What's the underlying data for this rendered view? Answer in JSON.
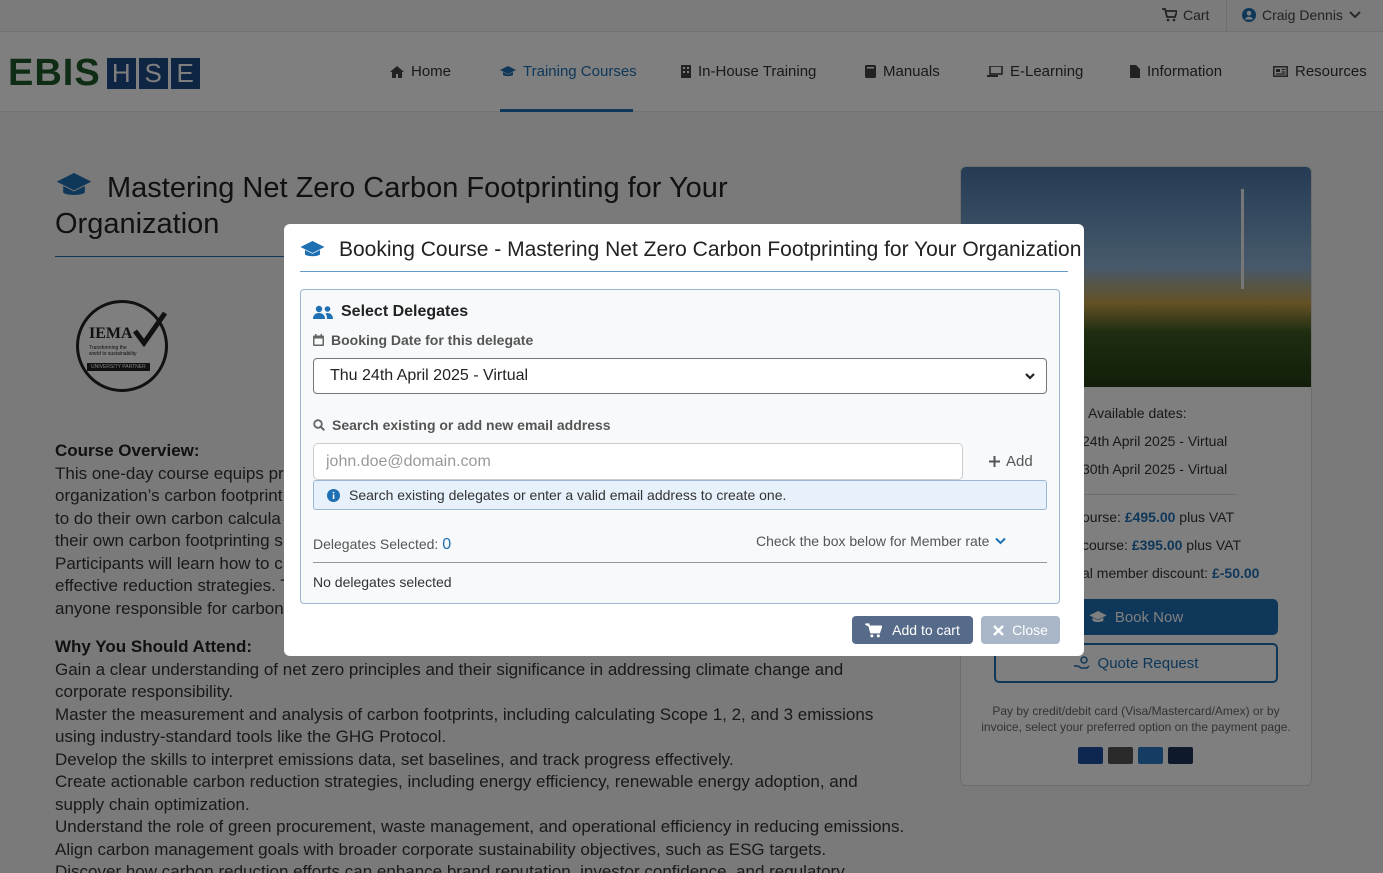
{
  "topbar": {
    "cart_label": "Cart",
    "user_name": "Craig Dennis"
  },
  "logo": {
    "primary": "EBIS",
    "letters": [
      "H",
      "S",
      "E"
    ]
  },
  "nav": {
    "items": [
      {
        "label": "Home",
        "icon": "home-icon"
      },
      {
        "label": "Training Courses",
        "icon": "graduation-cap-icon",
        "active": true
      },
      {
        "label": "In-House Training",
        "icon": "building-icon"
      },
      {
        "label": "Manuals",
        "icon": "book-icon"
      },
      {
        "label": "E-Learning",
        "icon": "laptop-icon"
      },
      {
        "label": "Information",
        "icon": "file-icon"
      },
      {
        "label": "Resources",
        "icon": "newspaper-icon"
      }
    ]
  },
  "page": {
    "title": "Mastering Net Zero Carbon Footprinting for Your Organization",
    "badge": {
      "title": "IEMA",
      "tagline": "Transforming the world to sustainability",
      "ribbon": "UNIVERSITY PARTNER"
    },
    "overview_heading": "Course Overview:",
    "overview_lines": [
      "This one-day course equips pr",
      "organization’s carbon footprint",
      "to do their own carbon calcula",
      "their own carbon footprinting s",
      "Participants will learn how to c",
      "effective reduction strategies. T",
      "anyone responsible for carbon"
    ],
    "why_heading": "Why You Should Attend:",
    "why_lines": [
      "Gain a clear understanding of net zero principles and their significance in addressing climate change and",
      "corporate responsibility.",
      "Master the measurement and analysis of carbon footprints, including calculating Scope 1, 2, and 3 emissions",
      "using industry-standard tools like the GHG Protocol.",
      "Develop the skills to interpret emissions data, set baselines, and track progress effectively.",
      "Create actionable carbon reduction strategies, including energy efficiency, renewable energy adoption, and",
      "supply chain optimization.",
      "Understand the role of green procurement, waste management, and operational efficiency in reducing emissions.",
      "Align carbon management goals with broader corporate sustainability objectives, such as ESG targets.",
      "Discover how carbon reduction efforts can enhance brand reputation, investor confidence, and regulatory"
    ]
  },
  "card": {
    "available_label": "Available dates:",
    "dates": [
      "24th April 2025 - Virtual",
      "30th April 2025 - Virtual"
    ],
    "price_lines": [
      {
        "prefix": "ourse: ",
        "price": "£495.00",
        "suffix": " plus VAT"
      },
      {
        "prefix": "course: ",
        "price": "£395.00",
        "suffix": " plus VAT"
      },
      {
        "prefix": "al member discount: ",
        "price": "£-50.00",
        "suffix": ""
      }
    ],
    "book_label": "Book Now",
    "quote_label": "Quote Request",
    "pay_text": "Pay by credit/debit card (Visa/Mastercard/Amex) or by invoice, select your preferred option on the payment page.",
    "pay_icons": [
      {
        "label": "VISA",
        "color": "#1a4fa0"
      },
      {
        "label": "MC",
        "color": "#555555"
      },
      {
        "label": "AMEX",
        "color": "#2a7bc8"
      },
      {
        "label": "INV",
        "color": "#1d3557"
      }
    ]
  },
  "modal": {
    "title": "Booking Course - Mastering Net Zero Carbon Footprinting for Your Organization",
    "panel_heading": "Select Delegates",
    "date_label": "Booking Date for this delegate",
    "date_value": "Thu 24th April 2025 - Virtual",
    "search_label": "Search existing or add new email address",
    "email_placeholder": "john.doe@domain.com",
    "add_label": "Add",
    "info_text": "Search existing delegates or enter a valid email address to create one.",
    "selected_label": "Delegates Selected: ",
    "selected_count": "0",
    "member_label": "Check the box below for Member rate",
    "no_delegates": "No delegates selected",
    "add_to_cart_label": "Add to cart",
    "close_label": "Close"
  },
  "colors": {
    "accent": "#1f6fb3",
    "brand_green": "#1e5a2a",
    "brand_blue": "#1d4a88",
    "cart_button": "#566a89",
    "close_button": "#a9b6c8"
  }
}
